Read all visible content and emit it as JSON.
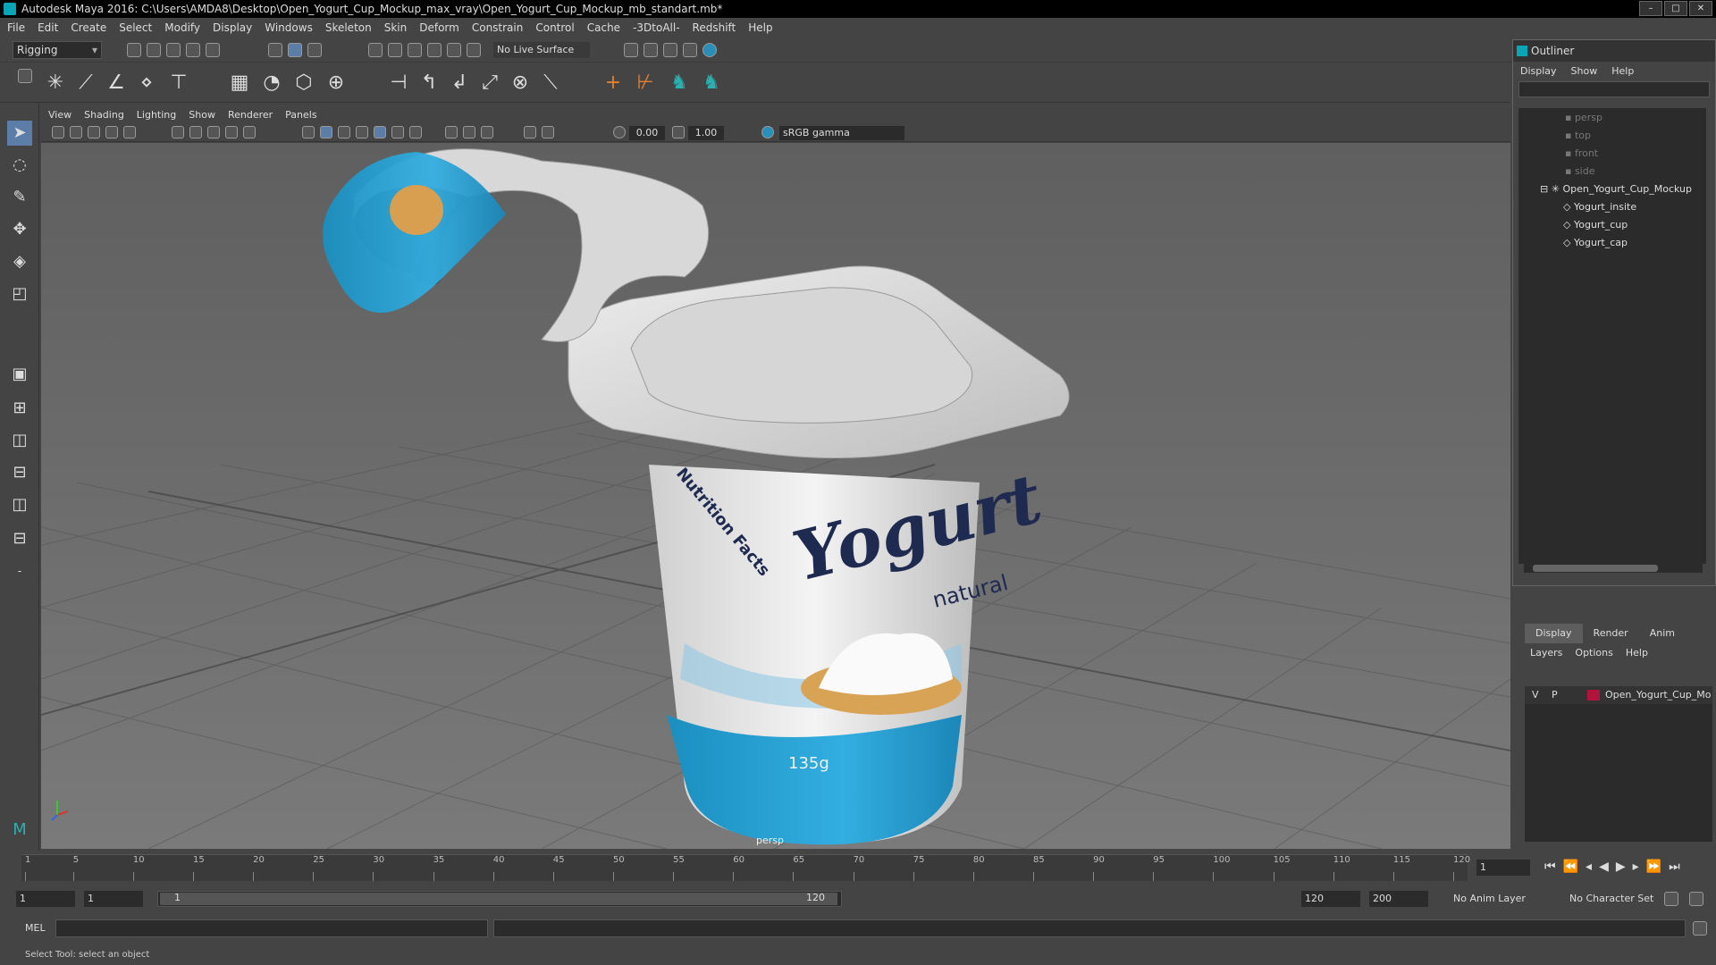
{
  "window": {
    "title": "Autodesk Maya 2016: C:\\Users\\AMDA8\\Desktop\\Open_Yogurt_Cup_Mockup_max_vray\\Open_Yogurt_Cup_Mockup_mb_standart.mb*"
  },
  "menubar": [
    "File",
    "Edit",
    "Create",
    "Select",
    "Modify",
    "Display",
    "Windows",
    "Skeleton",
    "Skin",
    "Deform",
    "Constrain",
    "Control",
    "Cache",
    "-3DtoAll-",
    "Redshift",
    "Help"
  ],
  "toolbar": {
    "mode": "Rigging",
    "live_surface": "No Live Surface"
  },
  "viewport": {
    "menu": [
      "View",
      "Shading",
      "Lighting",
      "Show",
      "Renderer",
      "Panels"
    ],
    "near_value": "0.00",
    "far_value": "1.00",
    "color_space": "sRGB gamma",
    "camera_label": "persp",
    "product_brand": "Yogurt",
    "product_sub": "natural",
    "product_weight": "135g",
    "product_panel": "Nutrition Facts"
  },
  "outliner": {
    "title": "Outliner",
    "menu": [
      "Display",
      "Show",
      "Help"
    ],
    "items": [
      {
        "label": "persp",
        "type": "camera"
      },
      {
        "label": "top",
        "type": "camera"
      },
      {
        "label": "front",
        "type": "camera"
      },
      {
        "label": "side",
        "type": "camera"
      },
      {
        "label": "Open_Yogurt_Cup_Mockup",
        "type": "group"
      },
      {
        "label": "Yogurt_insite",
        "type": "mesh"
      },
      {
        "label": "Yogurt_cup",
        "type": "mesh"
      },
      {
        "label": "Yogurt_cap",
        "type": "mesh"
      }
    ]
  },
  "layers": {
    "tabs": [
      "Display",
      "Render",
      "Anim"
    ],
    "menu": [
      "Layers",
      "Options",
      "Help"
    ],
    "row": {
      "v": "V",
      "p": "P",
      "name": "Open_Yogurt_Cup_Mo",
      "color": "#b0143c"
    }
  },
  "timeline": {
    "ticks": [
      "1",
      "5",
      "10",
      "15",
      "20",
      "25",
      "30",
      "35",
      "40",
      "45",
      "50",
      "55",
      "60",
      "65",
      "70",
      "75",
      "80",
      "85",
      "90",
      "95",
      "100",
      "105",
      "110",
      "115",
      "120"
    ],
    "current_frame": "1"
  },
  "range": {
    "start": "1",
    "playback_start": "1",
    "slider_start": "1",
    "slider_end": "120",
    "playback_end": "120",
    "end": "200",
    "anim_layer": "No Anim Layer",
    "char_set": "No Character Set"
  },
  "mel": {
    "label": "MEL"
  },
  "status": {
    "text": "Select Tool: select an object"
  }
}
